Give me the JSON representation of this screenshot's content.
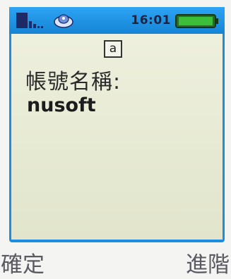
{
  "status_bar": {
    "signal_icon": "signal-strength-icon",
    "disc_icon": "disc-icon",
    "time": "16:01",
    "battery_icon": "battery-icon"
  },
  "editor": {
    "input_mode": "a",
    "label": "帳號名稱:",
    "value": "nusoft"
  },
  "softkeys": {
    "left": "確定",
    "right": "進階"
  },
  "colors": {
    "frame": "#1b8ee0",
    "screen": "#e9ebd6",
    "battery": "#3bbf3b"
  }
}
